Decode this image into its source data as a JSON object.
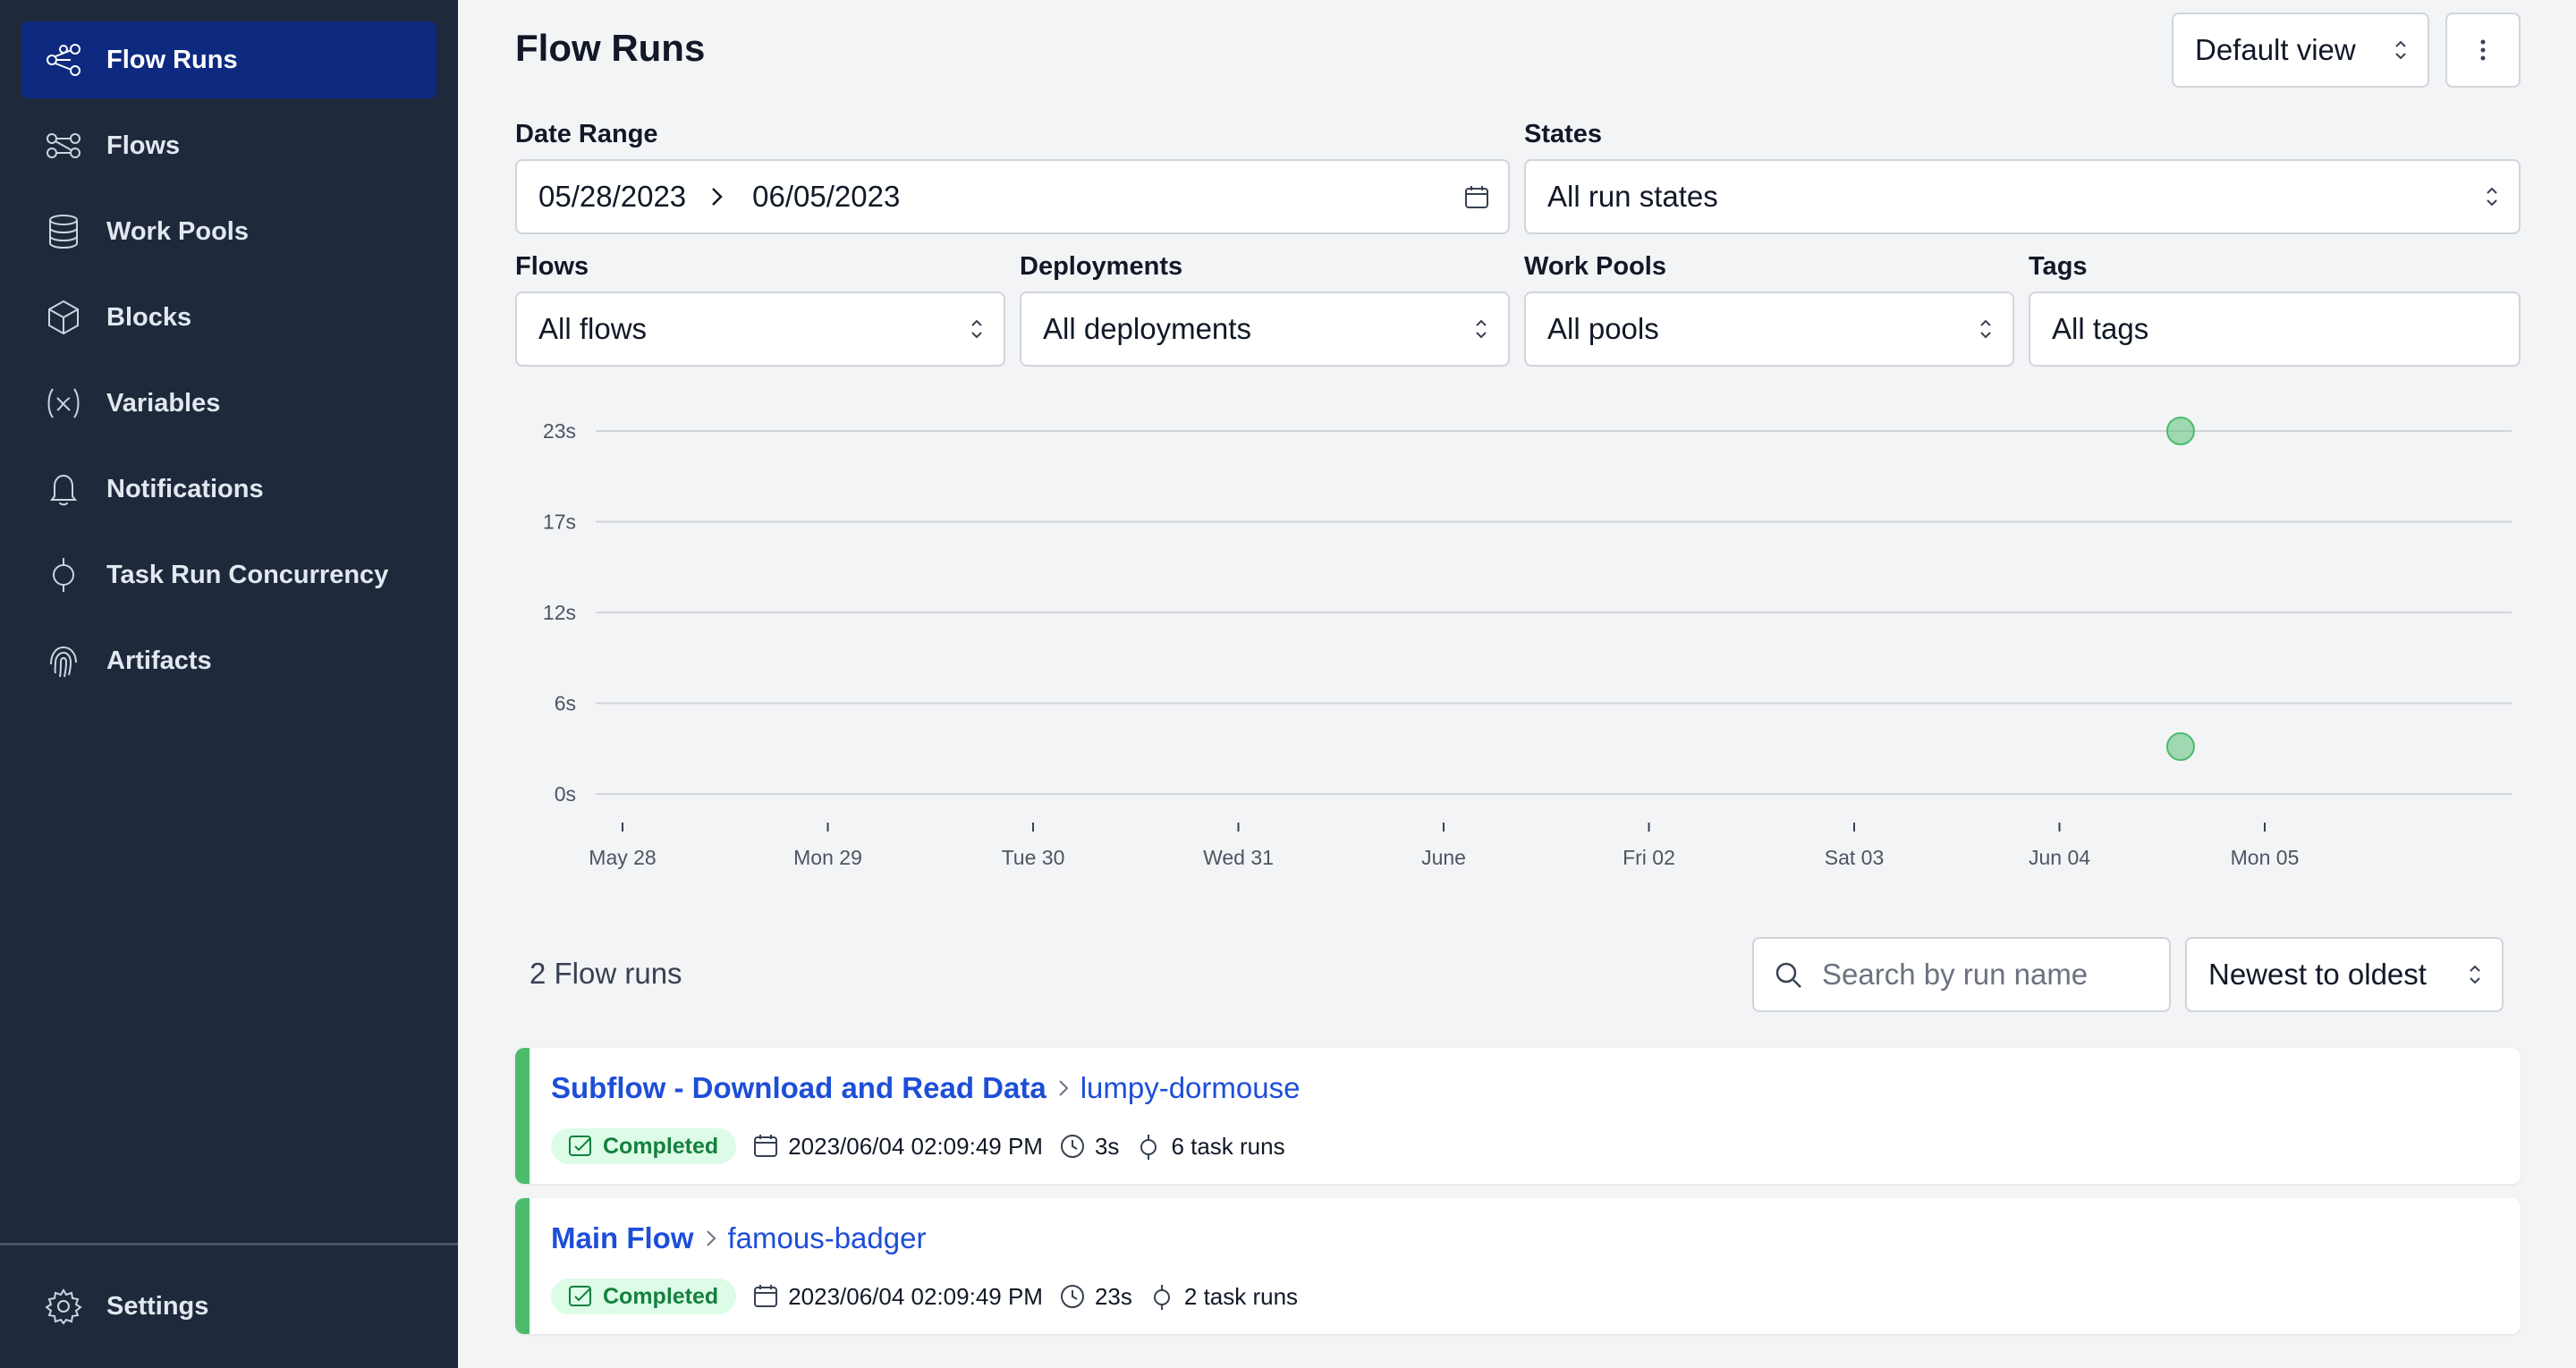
{
  "sidebar": {
    "items": [
      {
        "label": "Flow Runs",
        "icon": "flow-runs-icon",
        "active": true
      },
      {
        "label": "Flows",
        "icon": "flows-icon"
      },
      {
        "label": "Work Pools",
        "icon": "database-icon"
      },
      {
        "label": "Blocks",
        "icon": "cube-icon"
      },
      {
        "label": "Variables",
        "icon": "variable-icon"
      },
      {
        "label": "Notifications",
        "icon": "bell-icon"
      },
      {
        "label": "Task Run Concurrency",
        "icon": "concurrency-icon"
      },
      {
        "label": "Artifacts",
        "icon": "fingerprint-icon"
      }
    ],
    "settings_label": "Settings"
  },
  "header": {
    "title": "Flow Runs",
    "view_select": "Default view"
  },
  "filters": {
    "date_range_label": "Date Range",
    "date_start": "05/28/2023",
    "date_end": "06/05/2023",
    "states_label": "States",
    "states_value": "All run states",
    "flows_label": "Flows",
    "flows_value": "All flows",
    "deployments_label": "Deployments",
    "deployments_value": "All deployments",
    "work_pools_label": "Work Pools",
    "work_pools_value": "All pools",
    "tags_label": "Tags",
    "tags_value": "All tags"
  },
  "chart_data": {
    "type": "scatter",
    "x_ticks": [
      "May 28",
      "Mon 29",
      "Tue 30",
      "Wed 31",
      "June",
      "Fri 02",
      "Sat 03",
      "Jun 04",
      "Mon 05"
    ],
    "y_ticks": [
      "0s",
      "6s",
      "12s",
      "17s",
      "23s"
    ],
    "ylim": [
      0,
      23
    ],
    "points": [
      {
        "x": "2023-06-04 14:09:49",
        "y": 23
      },
      {
        "x": "2023-06-04 14:09:49",
        "y": 3
      }
    ],
    "point_color": "#4cbb6c"
  },
  "runs_section": {
    "count_label": "2 Flow runs",
    "search_placeholder": "Search by run name",
    "sort_value": "Newest to oldest"
  },
  "runs": [
    {
      "flow_name": "Subflow - Download and Read Data",
      "run_name": "lumpy-dormouse",
      "state": "Completed",
      "timestamp": "2023/06/04 02:09:49 PM",
      "duration": "3s",
      "task_runs": "6 task runs"
    },
    {
      "flow_name": "Main Flow",
      "run_name": "famous-badger",
      "state": "Completed",
      "timestamp": "2023/06/04 02:09:49 PM",
      "duration": "23s",
      "task_runs": "2 task runs"
    }
  ],
  "colors": {
    "sidebar_bg": "#1e293b",
    "active_nav": "#0d2a80",
    "link": "#1d4ed8",
    "completed": "#4cbb6c"
  }
}
